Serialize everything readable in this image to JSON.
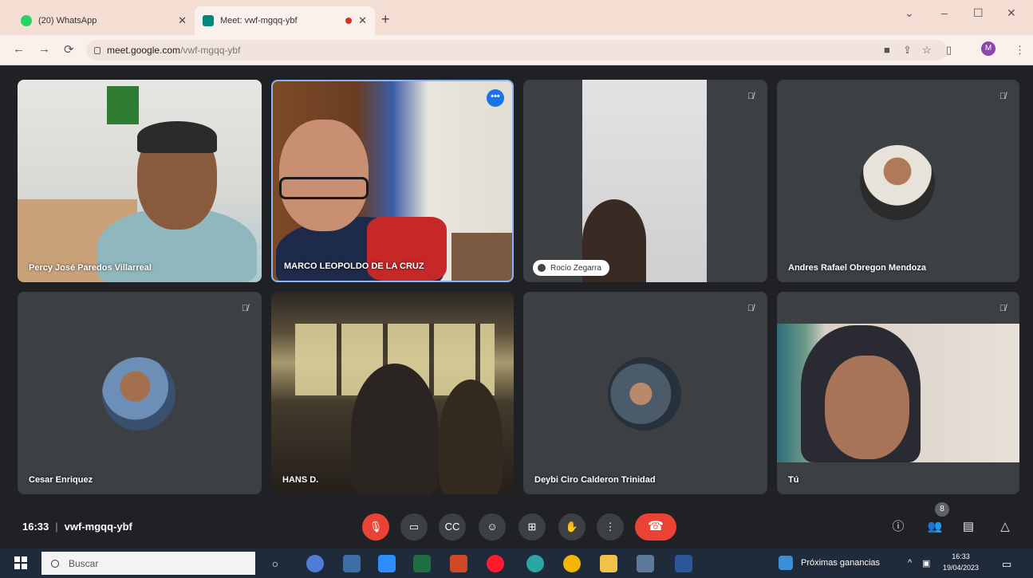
{
  "browser": {
    "tabs": [
      {
        "title": "(20) WhatsApp",
        "favicon_color": "#25d366",
        "active": false
      },
      {
        "title": "Meet: vwf-mgqq-ybf",
        "favicon_color": "#00897b",
        "active": true
      }
    ],
    "new_tab_label": "+",
    "window_controls": [
      "⌄",
      "–",
      "☐",
      "✕"
    ],
    "url_host": "meet.google.com",
    "url_path": "/vwf-mgqq-ybf",
    "profile_initial": "M"
  },
  "participants": [
    {
      "name": "Percy José Paredos Villarreal",
      "type": "video"
    },
    {
      "name": "MARCO LEOPOLDO DE LA CRUZ",
      "type": "video",
      "speaking": true
    },
    {
      "name": "Rocío Zegarra",
      "type": "video",
      "muted": true
    },
    {
      "name": "Andres Rafael Obregon Mendoza",
      "type": "avatar",
      "muted": true
    },
    {
      "name": "Cesar Enriquez",
      "type": "avatar",
      "muted": true
    },
    {
      "name": "HANS D.",
      "type": "video"
    },
    {
      "name": "Deybi Ciro Calderon Trinidad",
      "type": "avatar",
      "muted": true
    },
    {
      "name": "Tú",
      "type": "video",
      "muted": true
    }
  ],
  "controls": {
    "time": "16:33",
    "meeting_code": "vwf-mgqq-ybf",
    "participant_count": "8"
  },
  "taskbar": {
    "search_placeholder": "Buscar",
    "news_label": "Próximas ganancias",
    "clock_time": "16:33",
    "clock_date": "19/04/2023"
  },
  "colors": {
    "meet_bg": "#202124",
    "tile_bg": "#3c4043",
    "end_call": "#ea4335",
    "active_speaker": "#8ab4f8",
    "tab_strip": "#f4ddd2"
  }
}
